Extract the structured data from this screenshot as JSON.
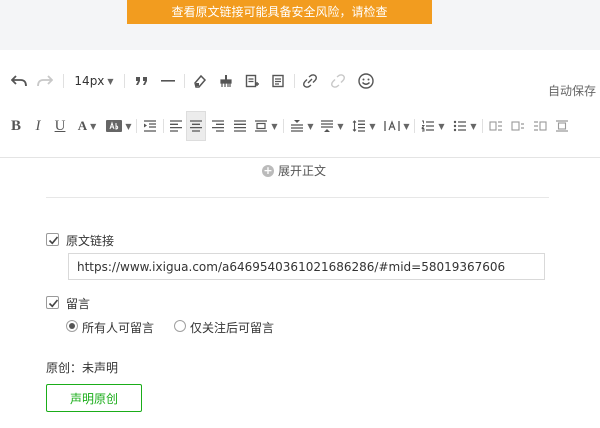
{
  "warning_banner": "查看原文链接可能具备安全风险，请检查",
  "toolbar": {
    "font_size": "14px",
    "autosave": "自动保存",
    "row1_icons": [
      "undo-icon",
      "redo-icon",
      "font-size-dropdown",
      "quote-icon",
      "horizontal-rule-icon",
      "eraser-icon",
      "format-painter-icon",
      "insert-template-icon",
      "template-list-icon",
      "link-icon",
      "unlink-icon",
      "emoji-icon"
    ],
    "row2_icons": [
      "bold-icon",
      "italic-icon",
      "underline-icon",
      "font-color-icon",
      "background-color-icon",
      "indent-icon",
      "align-left-icon",
      "align-center-icon",
      "align-right-icon",
      "align-justify-icon",
      "block-align-icon",
      "line-spacing-before-icon",
      "line-spacing-after-icon",
      "line-height-icon",
      "letter-spacing-icon",
      "ordered-list-icon",
      "unordered-list-icon",
      "image-float-left-icon",
      "image-float-none-icon",
      "image-float-right-icon",
      "image-center-icon"
    ]
  },
  "expand_text": "展开正文",
  "original_link": {
    "label": "原文链接",
    "checked": true,
    "value": "https://www.ixigua.com/a6469540361021686286/#mid=58019367606"
  },
  "comment": {
    "label": "留言",
    "checked": true,
    "options": [
      "所有人可留言",
      "仅关注后可留言"
    ],
    "selected": 0
  },
  "original": {
    "status": "原创：未声明",
    "button": "声明原创"
  },
  "colors": {
    "warning_bg": "#f29c1f",
    "accent_green": "#1aad19"
  }
}
